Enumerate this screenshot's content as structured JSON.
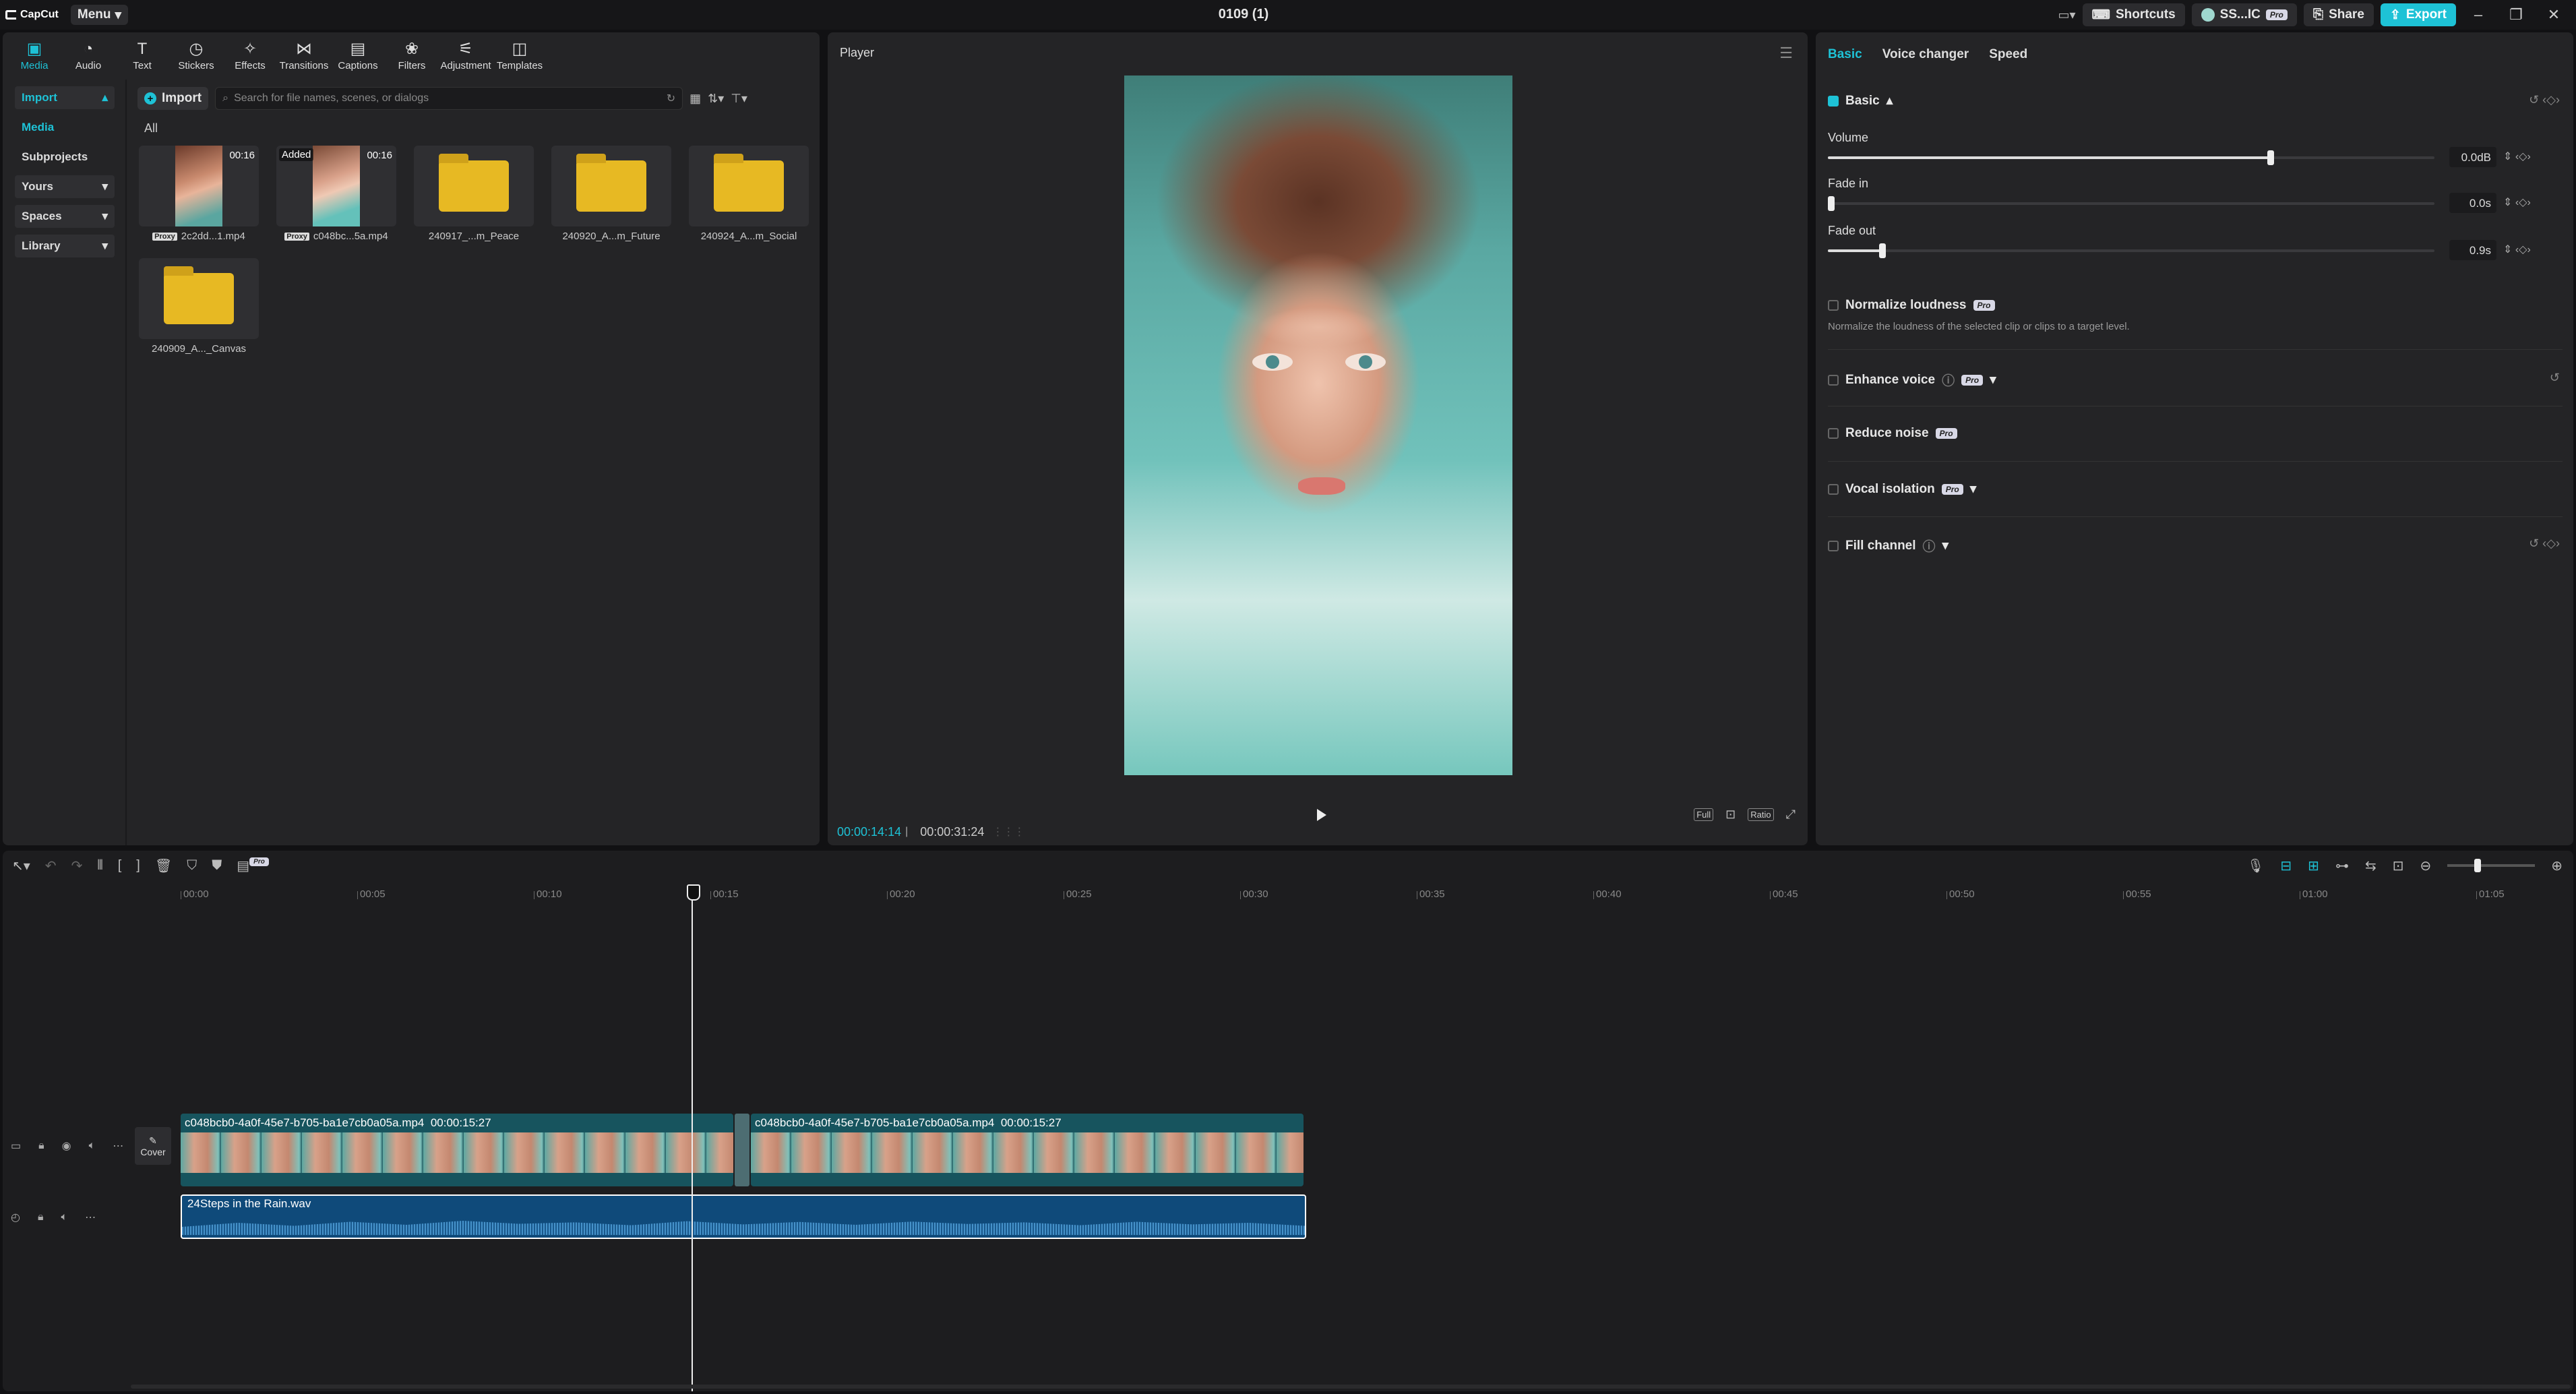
{
  "app": {
    "name": "CapCut",
    "menu_label": "Menu",
    "project_title": "0109 (1)"
  },
  "topbar": {
    "shortcuts": "Shortcuts",
    "user": "SS...IC",
    "pro_badge": "Pro",
    "share": "Share",
    "export": "Export"
  },
  "media_tabs": [
    {
      "label": "Media",
      "icon": "media-icon",
      "active": true
    },
    {
      "label": "Audio",
      "icon": "audio-icon"
    },
    {
      "label": "Text",
      "icon": "text-icon"
    },
    {
      "label": "Stickers",
      "icon": "stickers-icon"
    },
    {
      "label": "Effects",
      "icon": "effects-icon"
    },
    {
      "label": "Transitions",
      "icon": "transitions-icon"
    },
    {
      "label": "Captions",
      "icon": "captions-icon"
    },
    {
      "label": "Filters",
      "icon": "filters-icon"
    },
    {
      "label": "Adjustment",
      "icon": "adjustment-icon"
    },
    {
      "label": "Templates",
      "icon": "templates-icon"
    }
  ],
  "leftnav": {
    "import": "Import",
    "media": "Media",
    "subprojects": "Subprojects",
    "yours": "Yours",
    "spaces": "Spaces",
    "library": "Library"
  },
  "media_toolbar": {
    "import": "Import",
    "search_placeholder": "Search for file names, scenes, or dialogs"
  },
  "all_label": "All",
  "media_items": [
    {
      "type": "video",
      "name": "2c2dd...1.mp4",
      "duration": "00:16",
      "proxy": "Proxy"
    },
    {
      "type": "video",
      "name": "c048bc...5a.mp4",
      "duration": "00:16",
      "proxy": "Proxy",
      "added": "Added"
    },
    {
      "type": "folder",
      "name": "240917_...m_Peace"
    },
    {
      "type": "folder",
      "name": "240920_A...m_Future"
    },
    {
      "type": "folder",
      "name": "240924_A...m_Social"
    },
    {
      "type": "folder",
      "name": "240909_A..._Canvas"
    }
  ],
  "player": {
    "title": "Player",
    "current_time": "00:00:14:14",
    "total_time": "00:00:31:24",
    "full": "Full",
    "ratio": "Ratio"
  },
  "inspector": {
    "tabs": [
      "Basic",
      "Voice changer",
      "Speed"
    ],
    "basic_label": "Basic",
    "volume": {
      "label": "Volume",
      "value": "0.0dB",
      "level": 0.73
    },
    "fade_in": {
      "label": "Fade in",
      "value": "0.0s",
      "level": 0.0
    },
    "fade_out": {
      "label": "Fade out",
      "value": "0.9s",
      "level": 0.09
    },
    "normalize": {
      "label": "Normalize loudness",
      "badge": "Pro",
      "desc": "Normalize the loudness of the selected clip or clips to a target level."
    },
    "enhance": {
      "label": "Enhance voice",
      "badge": "Pro"
    },
    "reduce": {
      "label": "Reduce noise",
      "badge": "Pro"
    },
    "vocal": {
      "label": "Vocal isolation",
      "badge": "Pro"
    },
    "fill": {
      "label": "Fill channel"
    }
  },
  "timeline": {
    "ruler": [
      "00:00",
      "00:05",
      "00:10",
      "00:15",
      "00:20",
      "00:25",
      "00:30",
      "00:35",
      "00:40",
      "00:45",
      "00:50",
      "00:55",
      "01:00",
      "01:05"
    ],
    "cover": "Cover",
    "video_clips": [
      {
        "name": "c048bcb0-4a0f-45e7-b705-ba1e7cb0a05a.mp4",
        "duration": "00:00:15:27"
      },
      {
        "name": "c048bcb0-4a0f-45e7-b705-ba1e7cb0a05a.mp4",
        "duration": "00:00:15:27"
      }
    ],
    "audio_clip": {
      "name": "24Steps in the Rain.wav"
    },
    "pro_badge": "Pro"
  }
}
